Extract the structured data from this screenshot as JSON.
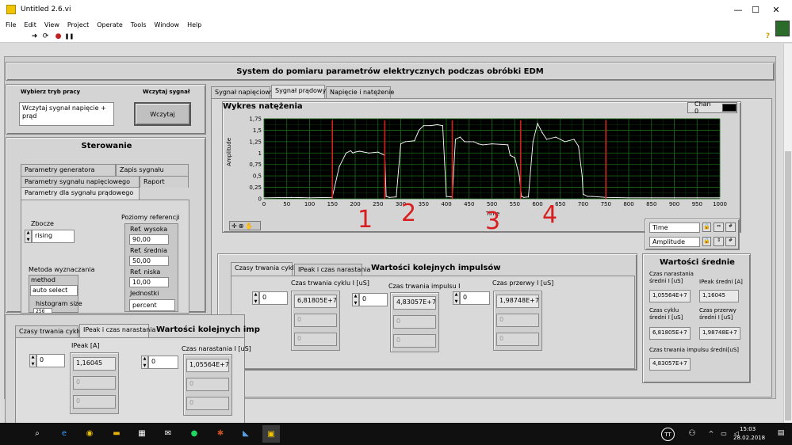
{
  "window": {
    "title": "Untitled 2.6.vi",
    "minimize": "—",
    "maximize": "☐",
    "close": "✕"
  },
  "menu": [
    "File",
    "Edit",
    "View",
    "Project",
    "Operate",
    "Tools",
    "Window",
    "Help"
  ],
  "toolbar": {
    "run": "➜",
    "run_cont": "⟳",
    "abort": "●",
    "pause": "❚❚",
    "help": "?"
  },
  "header": {
    "title": "System do pomiaru parametrów elektrycznych podczas obróbki EDM"
  },
  "mode": {
    "label": "Wybierz tryb pracy",
    "value": "Wczytaj sygnał napięcie + prąd",
    "load_label": "Wczytaj sygnał",
    "load_button": "Wczytaj"
  },
  "sterowanie": {
    "title": "Sterowanie",
    "tabs": [
      "Parametry generatora",
      "Zapis sygnału",
      "Parametry sygnału napięciowego",
      "Raport",
      "Parametry dla sygnału prądowego"
    ],
    "zbocze_label": "Zbocze",
    "zbocze_value": "rising",
    "poziomy_label": "Poziomy referencji",
    "ref_high_label": "Ref. wysoka",
    "ref_high_value": "90,00",
    "ref_mid_label": "Ref. średnia",
    "ref_mid_value": "50,00",
    "ref_low_label": "Ref. niska",
    "ref_low_value": "10,00",
    "jednostki_label": "Jednostki",
    "jednostki_value": "percent",
    "metoda_label": "Metoda wyznaczania",
    "method_label": "method",
    "method_value": "auto select",
    "histogram_label": "histogram size",
    "histogram_value": "256"
  },
  "main_tabs": [
    "Sygnał napięciowy",
    "Sygnał prądowy",
    "Napięcie i natężenie"
  ],
  "chart": {
    "title": "Wykres natężenia",
    "legend": "Chan 0",
    "xlabel": "Time",
    "ylabel": "Amplitude",
    "time_label": "Time",
    "amplitude_label": "Amplitude"
  },
  "chart_data": {
    "type": "line",
    "title": "Wykres natężenia",
    "xlabel": "Time",
    "ylabel": "Amplitude",
    "xlim": [
      0,
      1000
    ],
    "ylim": [
      0,
      1.75
    ],
    "xticks": [
      "0",
      "50",
      "100",
      "150",
      "200",
      "250",
      "300",
      "350",
      "400",
      "450",
      "500",
      "550",
      "600",
      "650",
      "700",
      "750",
      "800",
      "850",
      "900",
      "950",
      "1000"
    ],
    "yticks": [
      "0",
      "0,25",
      "0,5",
      "0,75",
      "1",
      "1,25",
      "1,5",
      "1,75"
    ],
    "series": [
      {
        "color": "#ffffff",
        "x": [
          0,
          60,
          100,
          148,
          150,
          165,
          180,
          190,
          195,
          200,
          210,
          230,
          250,
          265,
          268,
          275,
          290,
          300,
          310,
          330,
          340,
          350,
          365,
          380,
          392,
          400,
          410,
          413,
          420,
          430,
          440,
          450,
          460,
          470,
          480,
          500,
          520,
          535,
          540,
          550,
          560,
          565,
          570,
          580,
          590,
          600,
          610,
          620,
          640,
          660,
          680,
          690,
          698,
          700,
          710,
          720,
          750,
          800,
          850,
          900,
          950,
          1000
        ],
        "y": [
          0.02,
          0.03,
          0.02,
          0.03,
          0.05,
          0.7,
          1.0,
          1.05,
          1.0,
          1.02,
          1.04,
          1.0,
          1.02,
          0.95,
          0.05,
          0.03,
          0.04,
          1.2,
          1.25,
          1.27,
          1.5,
          1.6,
          1.6,
          1.62,
          1.6,
          0.05,
          0.04,
          0.05,
          1.3,
          1.35,
          1.25,
          1.25,
          1.25,
          1.2,
          1.18,
          1.2,
          1.19,
          1.18,
          0.95,
          0.9,
          0.5,
          0.05,
          0.03,
          0.04,
          1.25,
          1.65,
          1.45,
          1.3,
          1.35,
          1.25,
          1.3,
          1.15,
          0.5,
          0.1,
          0.05,
          0.05,
          0.03,
          0.02,
          0.02,
          0.02,
          0.02,
          0.02
        ]
      }
    ],
    "markers_x": [
      150,
      265,
      413,
      563,
      750
    ],
    "marker_color": "#d81e1e"
  },
  "annotations": [
    "1",
    "2",
    "3",
    "4"
  ],
  "pulses": {
    "title": "Wartości kolejnych impulsów",
    "tabs": [
      "Czasy trwania cyklu",
      "IPeak i czas narastania"
    ],
    "cycle_label": "Czas trwania cyklu I [uS]",
    "cycle_index": "0",
    "cycle_values": [
      "6,81805E+7",
      "0",
      "0"
    ],
    "impulse_label": "Czas trwania impulsu I",
    "impulse_index": "0",
    "impulse_values": [
      "4,83057E+7",
      "0",
      "0"
    ],
    "pause_label": "Czas przerwy I [uS]",
    "pause_index": "0",
    "pause_values": [
      "1,98748E+7",
      "0",
      "0"
    ]
  },
  "averages": {
    "title": "Wartości średnie",
    "rise_label": "Czas narastania średni I [uS]",
    "rise_value": "1,05564E+7",
    "ipeak_label": "IPeak średni [A]",
    "ipeak_value": "1,16045",
    "cycle_label": "Czas cyklu średni I [uS]",
    "cycle_value": "6,81805E+7",
    "pause_label": "Czas przerwy średni I [uS]",
    "pause_value": "1,98748E+7",
    "impulse_label": "Czas trwania impulsu średni[uS]",
    "impulse_value": "4,83057E+7"
  },
  "overlay": {
    "tabs": [
      "Czasy trwania cyklu",
      "IPeak i czas narastania"
    ],
    "title": "Wartości kolejnych imp",
    "ipeak_label": "IPeak [A]",
    "ipeak_index": "0",
    "ipeak_values": [
      "1,16045",
      "0",
      "0"
    ],
    "rise_label": "Czas narastania I  [uS]",
    "rise_index": "0",
    "rise_values": [
      "1,05564E+7",
      "0",
      "0"
    ]
  },
  "taskbar": {
    "user": "TT",
    "time": "15:03",
    "date": "28.02.2018"
  }
}
